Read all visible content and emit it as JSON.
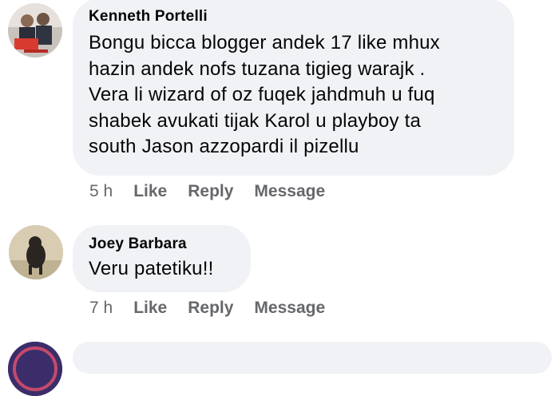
{
  "comments": [
    {
      "author": "Kenneth Portelli",
      "text": "Bongu bicca blogger  andek 17 like mhux\nhazin andek  nofs tuzana tigieg warajk .\nVera li wizard of oz fuqek  jahdmuh u fuq\nshabek avukati tijak  Karol u playboy ta\nsouth Jason azzopardi il pizellu",
      "time": "5 h",
      "like": "Like",
      "reply": "Reply",
      "message": "Message"
    },
    {
      "author": "Joey Barbara",
      "text": "Veru patetiku!!",
      "time": "7 h",
      "like": "Like",
      "reply": "Reply",
      "message": "Message"
    }
  ],
  "colors": {
    "bubble": "#f0f2f5",
    "text": "#050505",
    "meta": "#65676b"
  }
}
